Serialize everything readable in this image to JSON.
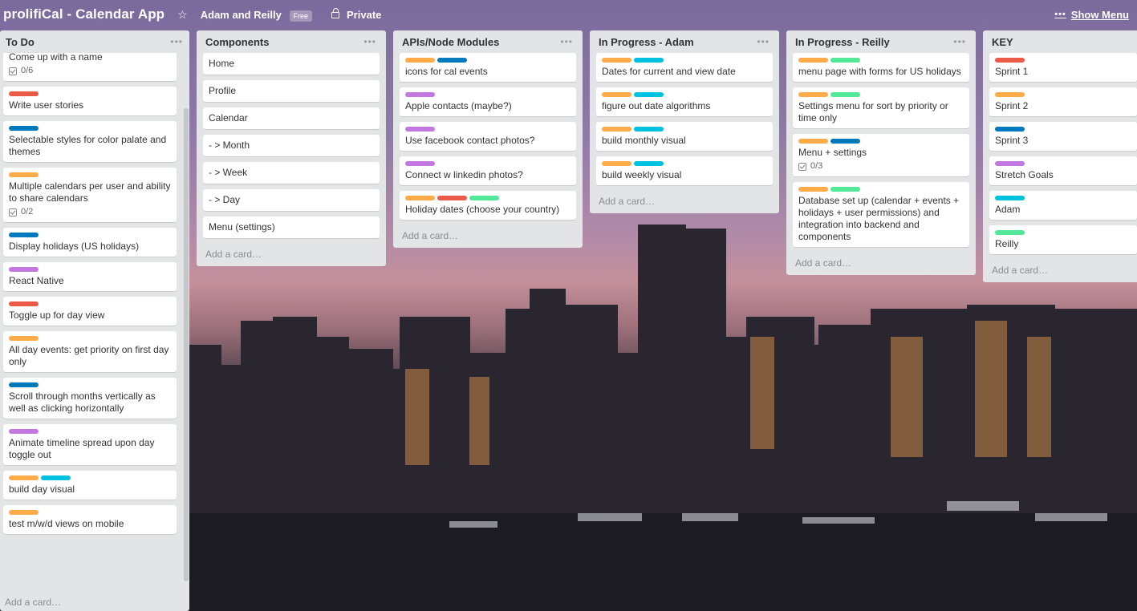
{
  "header": {
    "board_title": "prolifiCal - Calendar App",
    "team": "Adam and Reilly",
    "team_badge": "Free",
    "privacy": "Private",
    "show_menu": "Show Menu",
    "star_icon": "star-icon",
    "lock_icon": "lock-icon",
    "more_icon": "ellipsis-icon"
  },
  "colors": {
    "orange": "#ffab4a",
    "blue": "#0079bf",
    "red": "#eb5a46",
    "purple": "#c377e0",
    "green": "#51e898",
    "sky": "#00c2e0"
  },
  "add_card_label": "Add a card…",
  "lists": {
    "todo": {
      "title": "To Do",
      "cards": [
        {
          "text": "Come up with a name",
          "labels": [],
          "checklist": "0/6"
        },
        {
          "text": "Write user stories",
          "labels": [
            "red"
          ]
        },
        {
          "text": "Selectable styles for color palate and themes",
          "labels": [
            "blue"
          ]
        },
        {
          "text": "Multiple calendars per user and ability to share calendars",
          "labels": [
            "orange"
          ],
          "checklist": "0/2"
        },
        {
          "text": "Display holidays (US holidays)",
          "labels": [
            "blue"
          ]
        },
        {
          "text": "React Native",
          "labels": [
            "purple"
          ]
        },
        {
          "text": "Toggle up for day view",
          "labels": [
            "red"
          ]
        },
        {
          "text": "All day events: get priority on first day only",
          "labels": [
            "orange"
          ]
        },
        {
          "text": "Scroll through months vertically as well as clicking horizontally",
          "labels": [
            "blue"
          ]
        },
        {
          "text": "Animate timeline spread upon day toggle out",
          "labels": [
            "purple"
          ]
        },
        {
          "text": "build day visual",
          "labels": [
            "orange",
            "sky"
          ]
        },
        {
          "text": "test m/w/d views on mobile",
          "labels": [
            "orange"
          ]
        }
      ]
    },
    "components": {
      "title": "Components",
      "cards": [
        {
          "text": "Home"
        },
        {
          "text": "Profile"
        },
        {
          "text": "Calendar"
        },
        {
          "text": "- > Month"
        },
        {
          "text": "- > Week"
        },
        {
          "text": "- > Day"
        },
        {
          "text": "Menu (settings)"
        }
      ]
    },
    "apis": {
      "title": "APIs/Node Modules",
      "cards": [
        {
          "text": "icons for cal events",
          "labels": [
            "orange",
            "blue"
          ]
        },
        {
          "text": "Apple contacts (maybe?)",
          "labels": [
            "purple"
          ]
        },
        {
          "text": "Use facebook contact photos?",
          "labels": [
            "purple"
          ]
        },
        {
          "text": "Connect w linkedin photos?",
          "labels": [
            "purple"
          ]
        },
        {
          "text": "Holiday dates (choose your country)",
          "labels": [
            "orange",
            "red",
            "green"
          ]
        }
      ]
    },
    "adam": {
      "title": "In Progress - Adam",
      "cards": [
        {
          "text": "Dates for current and view date",
          "labels": [
            "orange",
            "sky"
          ]
        },
        {
          "text": "figure out date algorithms",
          "labels": [
            "orange",
            "sky"
          ]
        },
        {
          "text": "build monthly visual",
          "labels": [
            "orange",
            "sky"
          ]
        },
        {
          "text": "build weekly visual",
          "labels": [
            "orange",
            "sky"
          ]
        }
      ]
    },
    "reilly": {
      "title": "In Progress - Reilly",
      "cards": [
        {
          "text": "menu page with forms for US holidays",
          "labels": [
            "orange",
            "green"
          ]
        },
        {
          "text": "Settings menu for sort by priority or time only",
          "labels": [
            "orange",
            "green"
          ]
        },
        {
          "text": "Menu + settings",
          "labels": [
            "orange",
            "blue"
          ],
          "checklist": "0/3"
        },
        {
          "text": "Database set up (calendar + events + holidays + user permissions) and integration into backend and components",
          "labels": [
            "orange",
            "green"
          ]
        }
      ]
    },
    "key": {
      "title": "KEY",
      "cards": [
        {
          "text": "Sprint 1",
          "labels": [
            "red"
          ]
        },
        {
          "text": "Sprint 2",
          "labels": [
            "orange"
          ]
        },
        {
          "text": "Sprint 3",
          "labels": [
            "blue"
          ]
        },
        {
          "text": "Stretch Goals",
          "labels": [
            "purple"
          ]
        },
        {
          "text": "Adam",
          "labels": [
            "sky"
          ]
        },
        {
          "text": "Reilly",
          "labels": [
            "green"
          ]
        }
      ]
    }
  }
}
